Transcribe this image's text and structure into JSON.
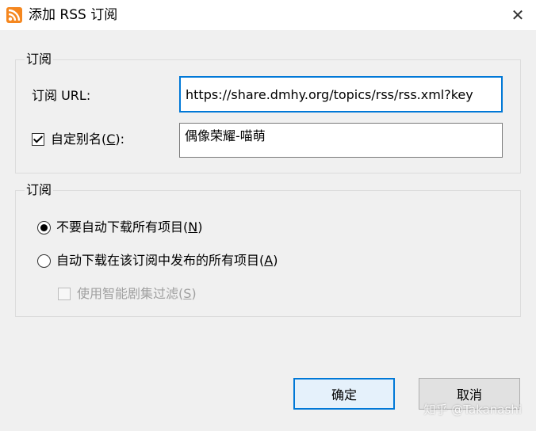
{
  "window": {
    "title": "添加 RSS 订阅",
    "icon": "rss-icon",
    "close_glyph": "✕"
  },
  "subscribe_group": {
    "legend": "订阅",
    "url_label": "订阅 URL:",
    "url_value": "https://share.dmhy.org/topics/rss/rss.xml?key",
    "alias_label_pre": "自定别名(",
    "alias_label_key": "C",
    "alias_label_post": "):",
    "alias_checked": true,
    "alias_value": "偶像荣耀-喵萌"
  },
  "download_group": {
    "legend": "订阅",
    "option1_pre": "不要自动下载所有项目(",
    "option1_key": "N",
    "option1_post": ")",
    "option1_selected": true,
    "option2_pre": "自动下载在该订阅中发布的所有项目(",
    "option2_key": "A",
    "option2_post": ")",
    "option2_selected": false,
    "filter_pre": "使用智能剧集过滤(",
    "filter_key": "S",
    "filter_post": ")",
    "filter_checked": false
  },
  "buttons": {
    "ok": "确定",
    "cancel": "取消"
  },
  "watermark": "知乎 @Takanashi",
  "colors": {
    "accent": "#0078d7",
    "rss_orange": "#f5871f"
  }
}
